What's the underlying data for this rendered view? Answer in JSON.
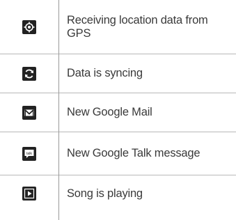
{
  "rows": [
    {
      "icon": "gps-location-icon",
      "label": "Receiving location data from GPS"
    },
    {
      "icon": "sync-icon",
      "label": "Data is syncing"
    },
    {
      "icon": "gmail-icon",
      "label": "New Google Mail"
    },
    {
      "icon": "google-talk-icon",
      "icon_text": "talk",
      "label": "New Google Talk message"
    },
    {
      "icon": "play-icon",
      "label": "Song is playing"
    }
  ]
}
